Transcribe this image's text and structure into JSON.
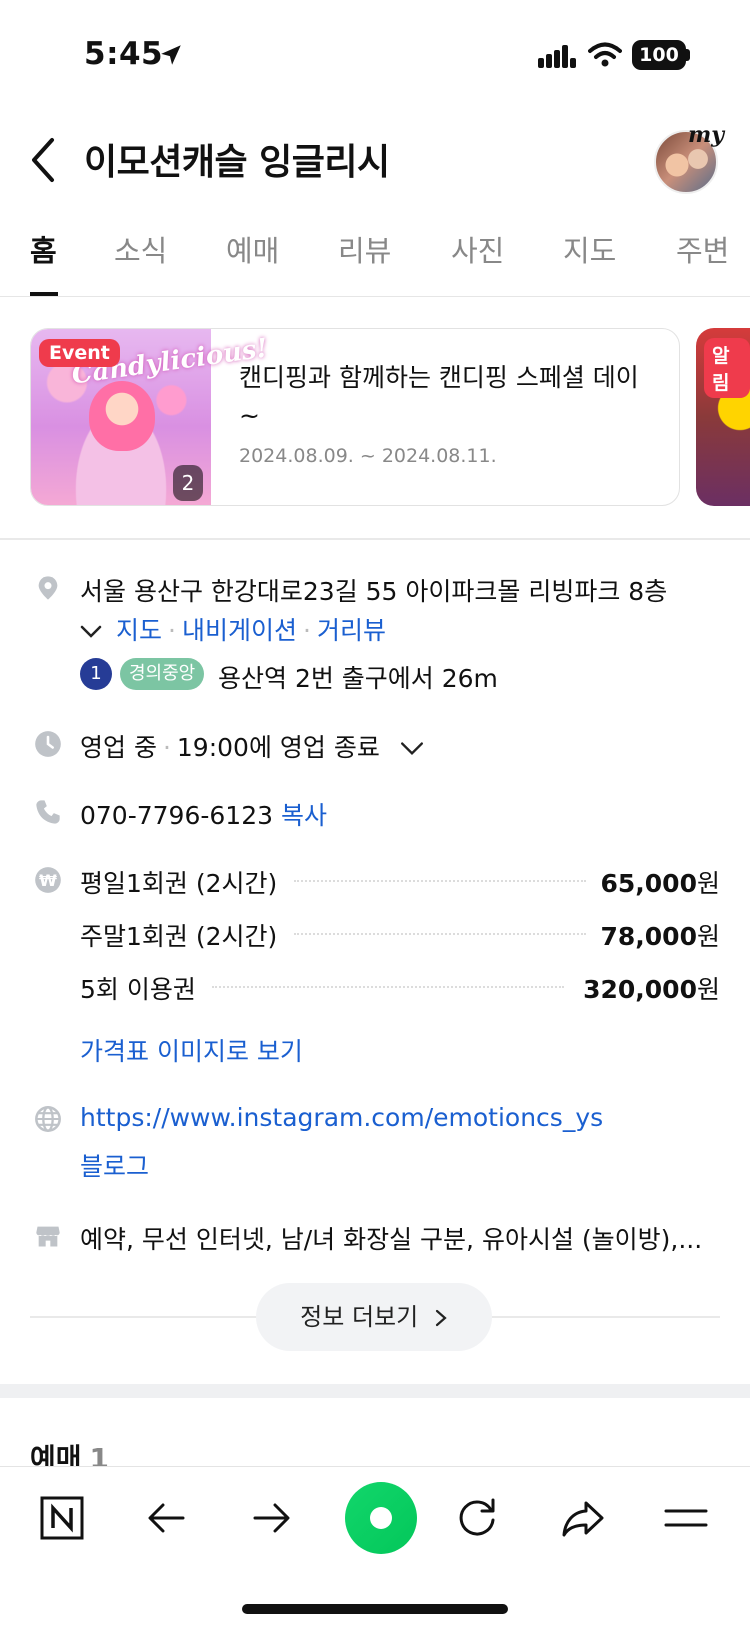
{
  "status_bar": {
    "time": "5:45",
    "battery": "100"
  },
  "header": {
    "title": "이모션캐슬 잉글리시",
    "avatar_label": "my"
  },
  "tabs": [
    "홈",
    "소식",
    "예매",
    "리뷰",
    "사진",
    "지도",
    "주변"
  ],
  "event": {
    "badge": "Event",
    "thumb_title": "Candylicious!",
    "image_count": "2",
    "title": "캔디핑과 함께하는 캔디핑 스페셜 데이 ~",
    "date": "2024.08.09. ~ 2024.08.11.",
    "next_badge": "알림"
  },
  "info": {
    "address": "서울 용산구 한강대로23길 55 아이파크몰 리빙파크 8층",
    "map_links": [
      "지도",
      "내비게이션",
      "거리뷰"
    ],
    "subway_line_number": "1",
    "subway_line_name": "경의중앙",
    "subway_text": "용산역 2번 출구에서 26m",
    "hours_status": "영업 중",
    "hours_detail": "19:00에 영업 종료",
    "phone": "070-7796-6123",
    "copy_label": "복사",
    "prices": [
      {
        "label": "평일1회권 (2시간)",
        "amount": "65,000",
        "unit": "원"
      },
      {
        "label": "주말1회권 (2시간)",
        "amount": "78,000",
        "unit": "원"
      },
      {
        "label": "5회 이용권",
        "amount": "320,000",
        "unit": "원"
      }
    ],
    "price_image_link": "가격표 이미지로 보기",
    "homepage": "https://www.instagram.com/emotioncs_ys",
    "blog": "블로그",
    "facilities": "예약, 무선 인터넷, 남/녀 화장실 구분, 유아시설 (놀이방),..."
  },
  "more_button": "정보 더보기",
  "booking": {
    "heading": "예매",
    "count": "1"
  },
  "colors": {
    "link": "#1a5fd0",
    "naver_green": "#03c75a",
    "event_red": "#ef3b4c"
  }
}
